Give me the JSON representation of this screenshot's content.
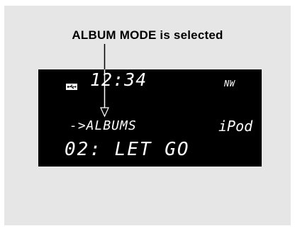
{
  "caption": "ALBUM MODE is selected",
  "display": {
    "clock": "12:34",
    "network": "NW",
    "menu": "->ALBUMS",
    "source": "iPod",
    "track": "02: LET GO"
  },
  "icons": {
    "usb": "usb-icon",
    "pointer": "arrow-down-icon"
  },
  "colors": {
    "background": "#e6e6e6",
    "lcd": "#000000",
    "lcd_text": "#ffffff",
    "caption_text": "#000000"
  }
}
